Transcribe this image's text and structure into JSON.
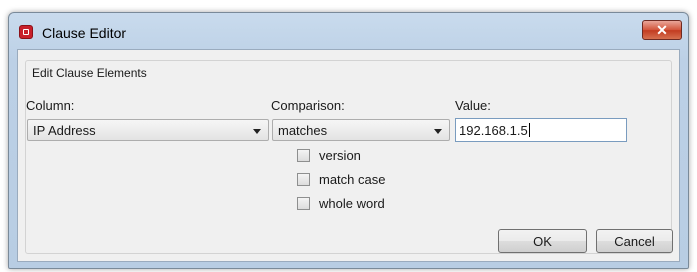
{
  "window": {
    "title": "Clause Editor",
    "close_label": "✕"
  },
  "group": {
    "legend": "Edit Clause Elements"
  },
  "column": {
    "label": "Column:",
    "selected": "IP Address"
  },
  "comparison": {
    "label": "Comparison:",
    "selected": "matches"
  },
  "value": {
    "label": "Value:",
    "text": "192.168.1.5"
  },
  "options": [
    {
      "label": "version",
      "checked": false
    },
    {
      "label": "match case",
      "checked": false
    },
    {
      "label": "whole word",
      "checked": false
    }
  ],
  "buttons": {
    "ok": "OK",
    "cancel": "Cancel"
  }
}
